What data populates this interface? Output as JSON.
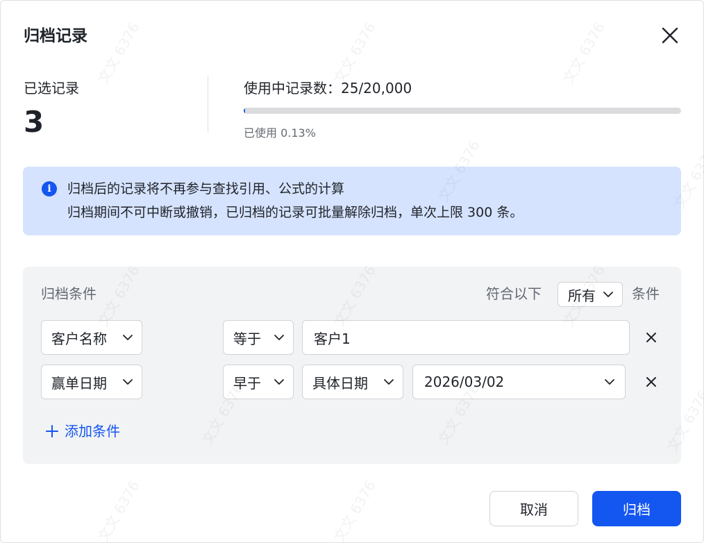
{
  "dialog": {
    "title": "归档记录",
    "close_icon": "close-icon"
  },
  "summary": {
    "selected_label": "已选记录",
    "selected_count": "3",
    "usage_label": "使用中记录数：25/20,000",
    "usage_fraction": 0.00125,
    "usage_percent_text": "已使用 0.13%"
  },
  "notice": {
    "icon": "info-icon",
    "line1": "归档后的记录将不再参与查找引用、公式的计算",
    "line2": "归档期间不可中断或撤销，已归档的记录可批量解除归档，单次上限 300 条。"
  },
  "conditions": {
    "title": "归档条件",
    "match_prefix": "符合以下",
    "match_value": "所有",
    "match_suffix": "条件",
    "rows": [
      {
        "field": "客户名称",
        "operator": "等于",
        "value": "客户1"
      },
      {
        "field": "赢单日期",
        "operator": "早于",
        "date_mode": "具体日期",
        "value": "2026/03/02"
      }
    ],
    "add_label": "添加条件"
  },
  "footer": {
    "cancel_label": "取消",
    "confirm_label": "归档"
  },
  "colors": {
    "accent": "#1456f0",
    "notice_bg": "#d6e3fe",
    "panel_bg": "#f2f3f5"
  }
}
